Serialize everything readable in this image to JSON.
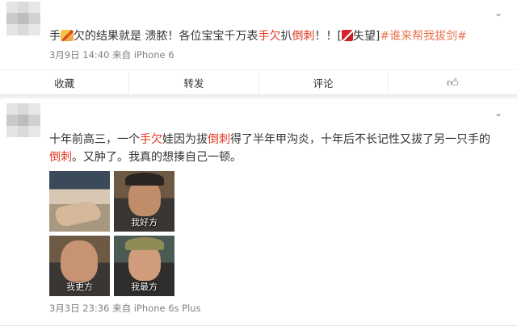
{
  "post1": {
    "text_pre": "手",
    "text_mid": "欠的结果就是 溃脓！各位宝宝千万表",
    "hl1": "手欠",
    "text_mid2": "扒",
    "hl2": "倒刺",
    "text_mid3": "！！[",
    "text_after_emoji": "失望]",
    "hashtag": "#谁来帮我拔剑#",
    "meta": "3月9日 14:40 来自 iPhone 6",
    "actions": {
      "favorite": "收藏",
      "repost": "转发",
      "comment": "评论",
      "like_icon": "thumbs-up"
    }
  },
  "post2": {
    "t1": "十年前高三，一个",
    "hl1": "手欠",
    "t2": "娃因为拔",
    "hl2": "倒刺",
    "t3": "得了半年甲沟炎，十年后不长记性又拔了另一只手的",
    "hl3": "倒刺",
    "t4": "。又肿了。我真的想揍自己一顿。",
    "captions": [
      "我好方",
      "我更方",
      "我最方"
    ],
    "meta": "3月3日 23:36 来自 iPhone 6s Plus"
  }
}
